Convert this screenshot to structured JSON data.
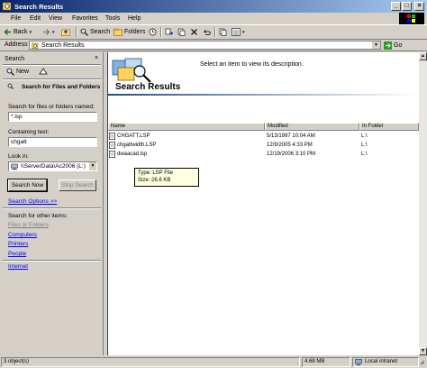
{
  "window": {
    "title": "Search Results"
  },
  "menu": [
    "File",
    "Edit",
    "View",
    "Favorites",
    "Tools",
    "Help"
  ],
  "toolbar": {
    "back_label": "Back",
    "search_label": "Search",
    "folders_label": "Folders"
  },
  "address": {
    "label": "Address",
    "value": "Search Results",
    "go_label": "Go"
  },
  "search_pane": {
    "title": "Search",
    "new_label": "New",
    "heading": "Search for Files and Folders",
    "named_label": "Search for files or folders named:",
    "named_value": "*.lsp",
    "containing_label": "Containing text:",
    "containing_value": "chgatt",
    "look_in_label": "Look in:",
    "look_in_value": "\\\\ServerData\\Ac2006 (L:)",
    "search_now_label": "Search Now",
    "stop_search_label": "Stop Search",
    "search_options_label": "Search Options  >>",
    "other_items_label": "Search for other items:",
    "other_items": [
      "Files or Folders",
      "Computers",
      "Printers",
      "People"
    ],
    "internet_label": "Internet"
  },
  "results": {
    "banner_title": "Search Results",
    "description_prompt": "Select an item to view its description.",
    "columns": [
      "Name",
      "Modified",
      "In Folder"
    ],
    "rows": [
      {
        "name": "CHGATT.LSP",
        "modified": "5/13/1997 10:04 AM",
        "folder": "L:\\"
      },
      {
        "name": "chgattwidth.LSP",
        "modified": "12/9/2005 4:33 PM",
        "folder": "L:\\"
      },
      {
        "name": "dwaacad.lsp",
        "modified": "12/19/2006 3:10 PM",
        "folder": "L:\\"
      }
    ],
    "tooltip_type": "Type: LSP File",
    "tooltip_size": "Size: 26.6 KB"
  },
  "status": {
    "objects": "3 object(s)",
    "size": "4.68 MB",
    "zone": "Local intranet"
  },
  "colors": {
    "title_start": "#0a246a",
    "title_end": "#a6caf0",
    "face": "#d4d0c8",
    "link": "#0000ff"
  }
}
